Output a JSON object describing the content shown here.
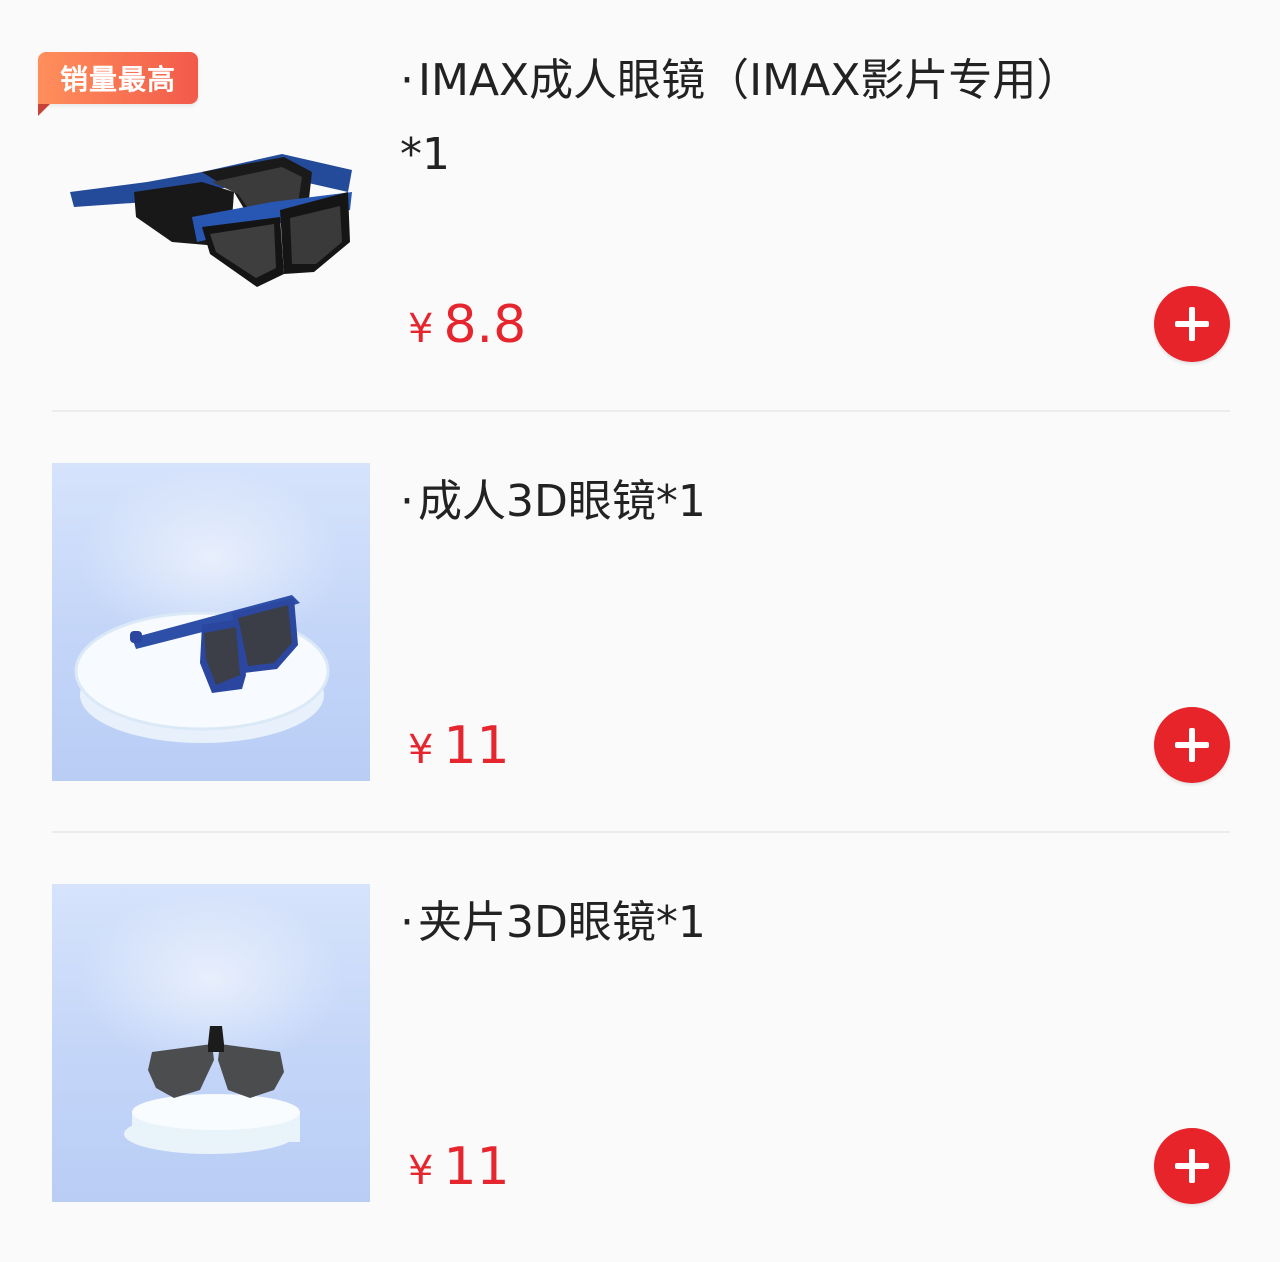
{
  "products": [
    {
      "badge": "销量最高",
      "title": "IMAX成人眼镜（IMAX影片专用）*1",
      "currency": "¥",
      "price": "8.8",
      "image_icon": "imax-3d-glasses-icon"
    },
    {
      "title": "成人3D眼镜*1",
      "currency": "¥",
      "price": "11",
      "image_icon": "adult-3d-glasses-icon"
    },
    {
      "title": "夹片3D眼镜*1",
      "currency": "¥",
      "price": "11",
      "image_icon": "clip-on-3d-glasses-icon"
    }
  ],
  "add_icon": "plus-icon",
  "colors": {
    "price": "#e5262f",
    "add_button": "#e8242b",
    "badge_start": "#ff8f5c",
    "badge_end": "#f25a4a",
    "divider": "#ececec"
  }
}
